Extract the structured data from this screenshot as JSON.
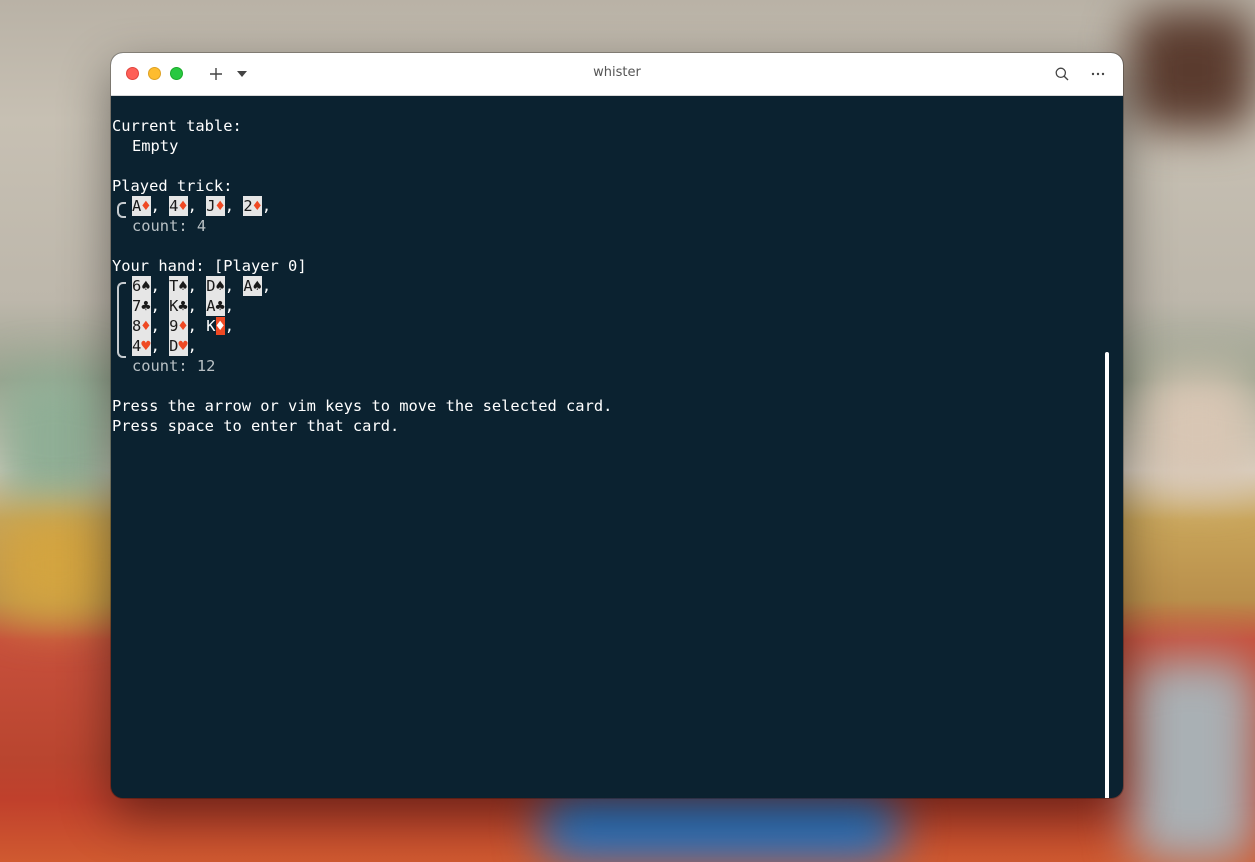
{
  "window": {
    "title": "whister"
  },
  "terminal": {
    "current_table_label": "Current table:",
    "current_table_value": "Empty",
    "played_trick_label": "Played trick:",
    "played_trick": [
      {
        "rank": "A",
        "suit": "♦",
        "color": "red"
      },
      {
        "rank": "4",
        "suit": "♦",
        "color": "red"
      },
      {
        "rank": "J",
        "suit": "♦",
        "color": "red"
      },
      {
        "rank": "2",
        "suit": "♦",
        "color": "red"
      }
    ],
    "played_trick_count": "count: 4",
    "hand_label": "Your hand: [Player 0]",
    "hand_rows": [
      [
        {
          "rank": "6",
          "suit": "♠",
          "color": "black"
        },
        {
          "rank": "T",
          "suit": "♠",
          "color": "black"
        },
        {
          "rank": "D",
          "suit": "♠",
          "color": "black"
        },
        {
          "rank": "A",
          "suit": "♠",
          "color": "black"
        }
      ],
      [
        {
          "rank": "7",
          "suit": "♣",
          "color": "black"
        },
        {
          "rank": "K",
          "suit": "♣",
          "color": "black"
        },
        {
          "rank": "A",
          "suit": "♣",
          "color": "black"
        }
      ],
      [
        {
          "rank": "8",
          "suit": "♦",
          "color": "red"
        },
        {
          "rank": "9",
          "suit": "♦",
          "color": "red"
        },
        {
          "rank": "K",
          "suit": "♦",
          "color": "red",
          "selected": true
        }
      ],
      [
        {
          "rank": "4",
          "suit": "♥",
          "color": "red"
        },
        {
          "rank": "D",
          "suit": "♥",
          "color": "red"
        }
      ]
    ],
    "hand_count": "count: 12",
    "help_line_1": "Press the arrow or vim keys to move the selected card.",
    "help_line_2": "Press space to enter that card."
  },
  "colors": {
    "terminal_bg": "#0b2230",
    "card_bg": "#e6e6e6",
    "suit_red": "#ef4923"
  },
  "icons": [
    "close-light",
    "minimize-light",
    "maximize-light",
    "plus-icon",
    "chevron-down-icon",
    "search-icon",
    "more-icon"
  ]
}
